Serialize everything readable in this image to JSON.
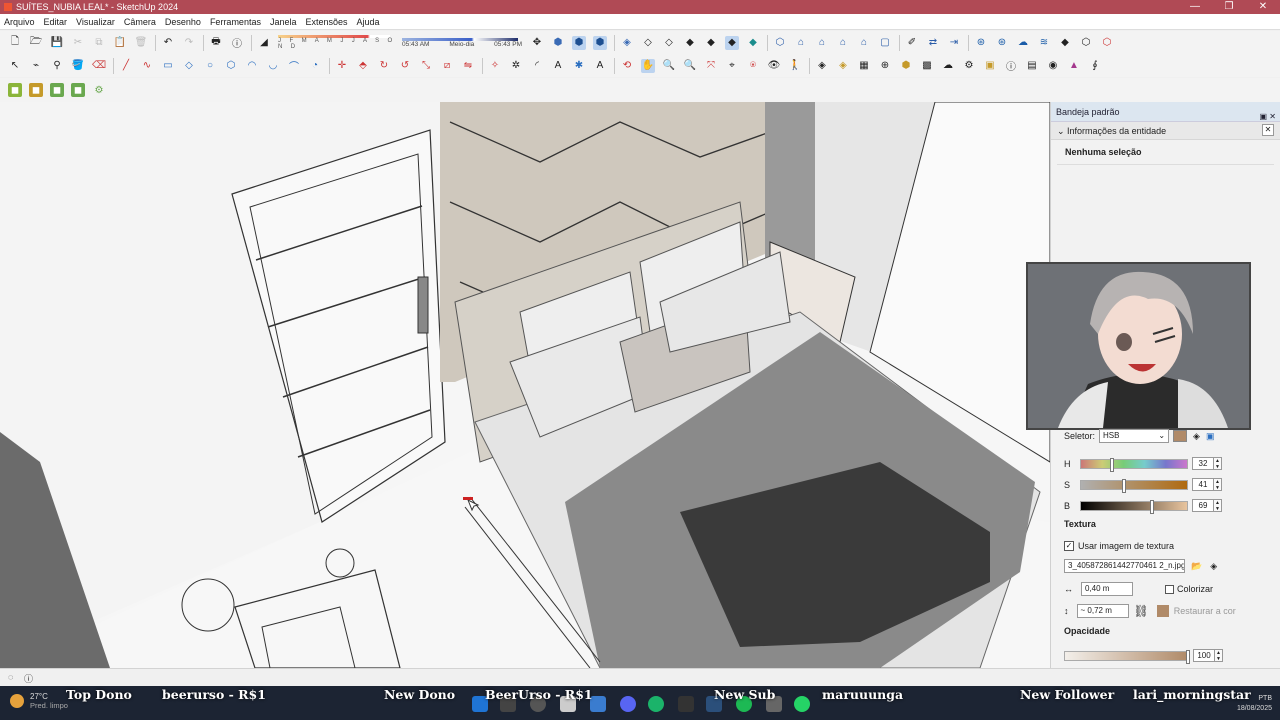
{
  "window": {
    "title": "SUÍTES_NUBIA LEAL* - SketchUp 2024",
    "controls": {
      "minimize": "—",
      "maximize": "❐",
      "close": "✕"
    }
  },
  "menu": [
    "Arquivo",
    "Editar",
    "Visualizar",
    "Câmera",
    "Desenho",
    "Ferramentas",
    "Janela",
    "Extensões",
    "Ajuda"
  ],
  "shadows": {
    "months": "J F M A M J J A S O N D",
    "time_start": "05:43 AM",
    "time_mid": "Meio-dia",
    "time_end": "05:43 PM"
  },
  "tray": {
    "title": "Bandeja padrão",
    "panel_title": "Informações da entidade",
    "no_selection": "Nenhuma seleção",
    "selector_label": "Seletor:",
    "selector_value": "HSB",
    "hsb": {
      "h_label": "H",
      "h_value": "32",
      "h_level": 0.29,
      "s_label": "S",
      "s_value": "41",
      "s_level": 0.41,
      "b_label": "B",
      "b_value": "69",
      "b_level": 0.69
    },
    "texture_heading": "Textura",
    "use_texture_label": "Usar imagem de textura",
    "texture_file": "3_405872861442770461 2_n.jpg",
    "width_value": "0,40 m",
    "height_value": "~ 0,72 m",
    "colorize_label": "Colorizar",
    "restore_label": "Restaurar a cor",
    "opacity_heading": "Opacidade",
    "opacity_value": "100"
  },
  "stream": {
    "top_label": "Top Dono",
    "top_value": "beerurso - R$1",
    "new_dono_label": "New Dono",
    "new_dono_value": "BeerUrso - R$1",
    "new_sub_label": "New Sub",
    "new_sub_value": "maruuunga",
    "new_follower_label": "New Follower",
    "new_follower_value": "lari_morningstar"
  },
  "taskbar": {
    "temperature": "27°C",
    "condition": "Pred. limpo",
    "lang": "PTB",
    "date": "18/08/2025"
  },
  "colors": {
    "titlebar": "#b04a55",
    "swatch": "#b08a68",
    "taskbar": "#1c2433"
  }
}
